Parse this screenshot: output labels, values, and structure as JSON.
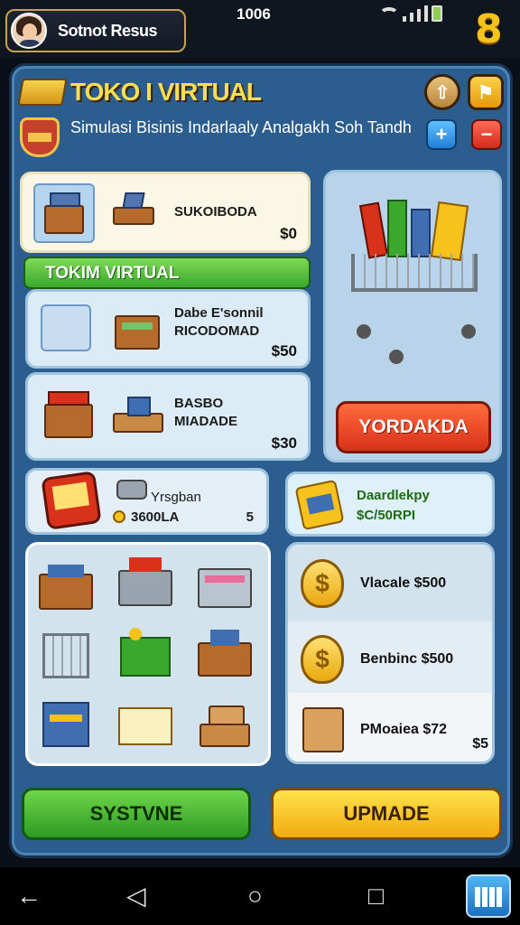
{
  "status_bar": {
    "time": "1006"
  },
  "profile": {
    "name": "Sotnot Resus"
  },
  "header": {
    "title": "TOKO I VIRTUAL",
    "subtitle": "Simulasi Bisinis Indarlaaly Analgakh Soh Tandh",
    "corner_badge": "8"
  },
  "header_buttons": {
    "up_arrow": "⇧",
    "flag": "⚑",
    "plus": "+",
    "minus": "−"
  },
  "shop_items": [
    {
      "label": "SUKOIBODA",
      "price": "$0"
    },
    {
      "label": "Dabe E'sonnil\nRICODOMAD",
      "price": "$50"
    },
    {
      "label": "BASBO\nMIADADE",
      "price": "$30"
    }
  ],
  "section_banner": "TOKIM VIRTUAL",
  "order_button": "YORDAKDA",
  "stats": {
    "left": {
      "label": "Yrsgban",
      "value": "3600LA",
      "count": "5"
    },
    "right": {
      "label": "Daardlekpy",
      "value": "$C/50RPI"
    }
  },
  "offers": [
    {
      "label": "Vlacale $500"
    },
    {
      "label": "Benbinc $500"
    },
    {
      "label": "PMoaiea $72",
      "badge": "$5"
    }
  ],
  "actions": {
    "system": "SYSTVNE",
    "upgrade": "UPMADE"
  },
  "colors": {
    "panel": "#2b5d8e",
    "title": "#f8dd55",
    "banner_green": "#3aa82c",
    "order_red": "#d8321a",
    "upgrade_yellow": "#f7c21c"
  }
}
